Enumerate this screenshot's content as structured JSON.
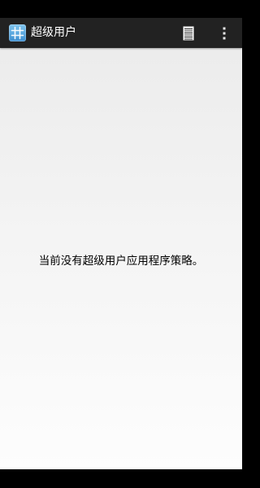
{
  "app": {
    "title": "超级用户",
    "icon": "superuser-grid-icon"
  },
  "toolbar": {
    "log_icon": "list-document-icon",
    "menu_icon": "overflow-menu-icon"
  },
  "content": {
    "empty_message": "当前没有超级用户应用程序策略。"
  },
  "colors": {
    "action_bar": "#222222",
    "background_top": "#ececec",
    "background_bottom": "#fdfdfd",
    "text_primary": "#000000",
    "title_text": "#ffffff",
    "icon_accent": "#3d8fd1"
  }
}
